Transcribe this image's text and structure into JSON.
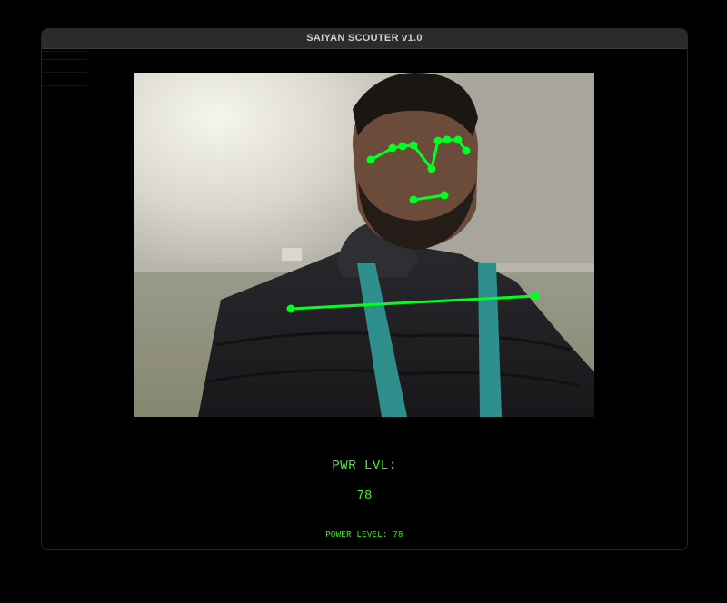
{
  "window": {
    "title": "SAIYAN SCOUTER v1.0"
  },
  "camera": {
    "overlay_color": "#00ff22"
  },
  "readout": {
    "label": "PWR LVL:",
    "value": "78",
    "status": "POWER LEVEL: 78"
  },
  "colors": {
    "accent": "#39ff14",
    "background": "#000000",
    "titlebar": "#2b2b2d"
  },
  "icons": {
    "cursor": "arrow-cursor-icon"
  }
}
